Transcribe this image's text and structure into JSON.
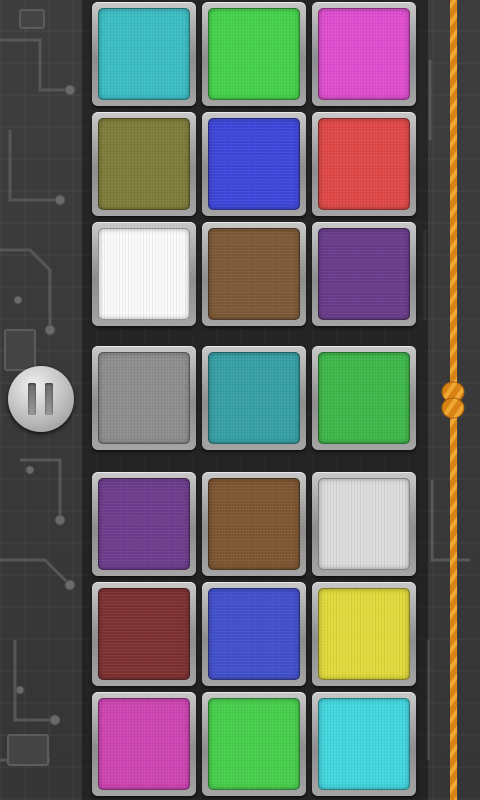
{
  "game": {
    "tile_colors": [
      [
        "#3cbec4",
        "#46d24c",
        "#e04ed0"
      ],
      [
        "#7f7d3a",
        "#3f47db",
        "#e04848"
      ],
      [
        "#fafafa",
        "#7e5937",
        "#6a3d8c"
      ],
      [
        "#8e8e8e",
        "#36a0a6",
        "#3fb84a"
      ],
      [
        "#6e3d8e",
        "#7d5632",
        "#dcdcdc"
      ],
      [
        "#7e3131",
        "#4250cc",
        "#e0da3c"
      ],
      [
        "#ce45b4",
        "#47cf4c",
        "#43d6de"
      ]
    ],
    "pause_icon": "pause-icon",
    "rope_icon": "rope-knot-icon",
    "rope_color": "#e08a1c"
  }
}
